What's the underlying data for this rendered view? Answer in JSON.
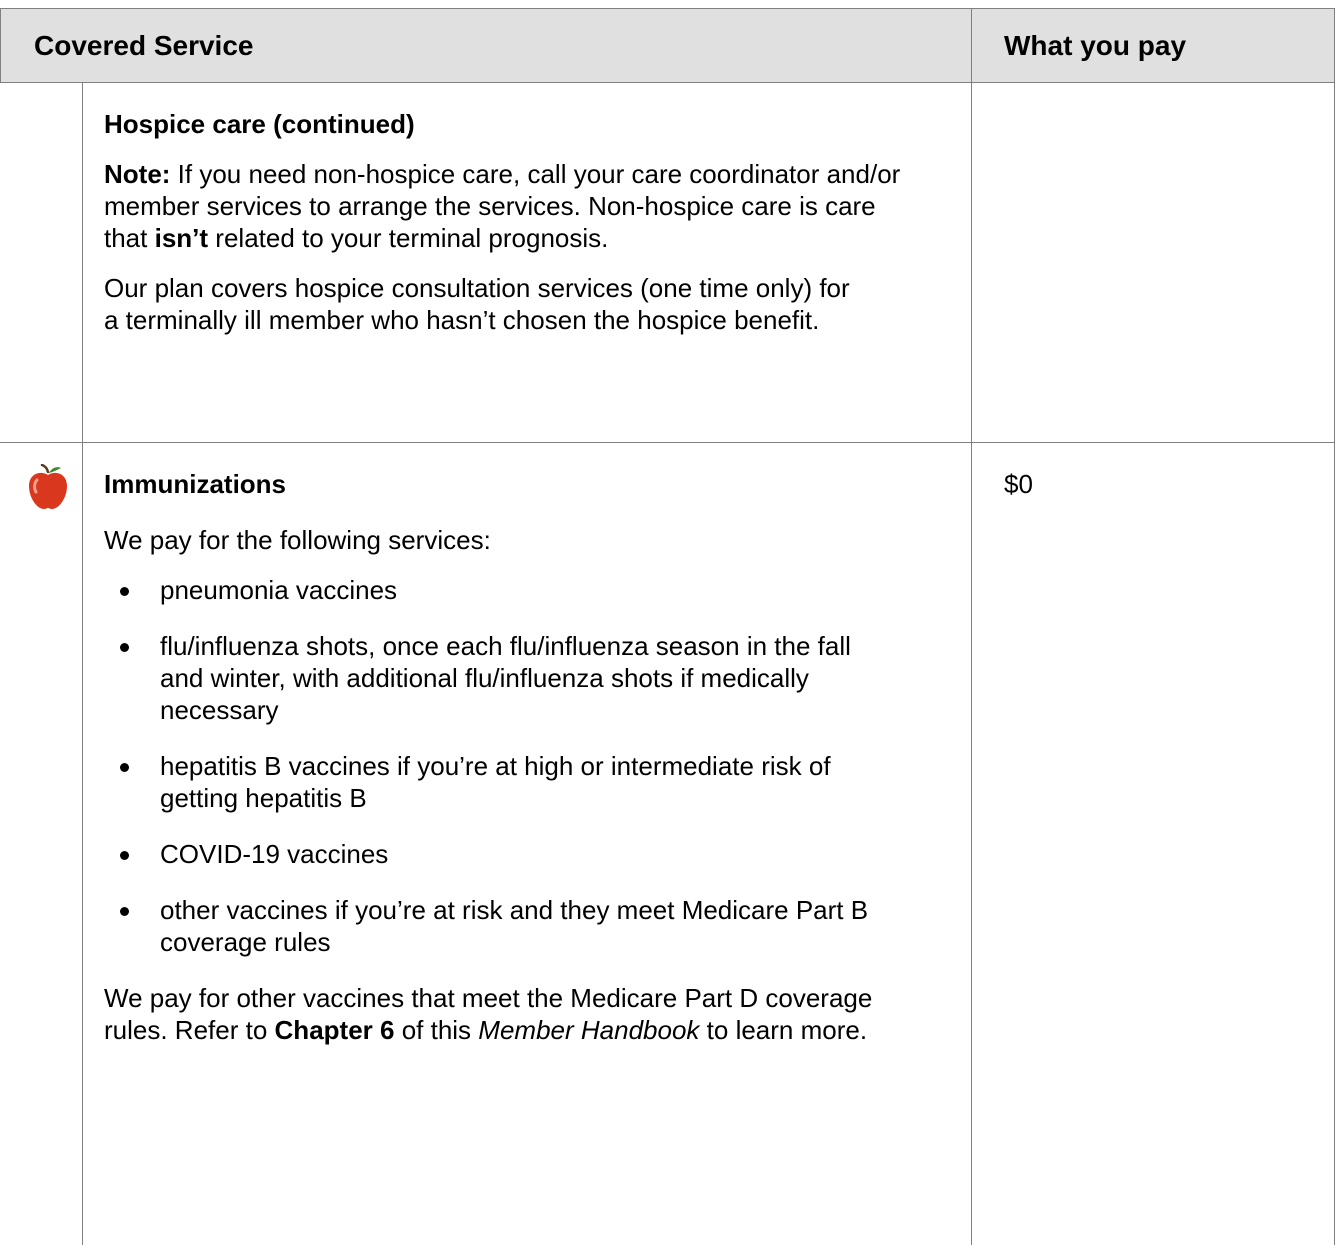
{
  "header": {
    "covered_service": "Covered Service",
    "what_you_pay": "What you pay"
  },
  "rows": [
    {
      "title": "Hospice care (continued)",
      "note_label": "Note:",
      "note_text_1": "If you need non-hospice care, call your care coordinator and/or member services to arrange the services. Non-hospice care is care that",
      "note_bold": "isn’t",
      "note_text_2": "related to your terminal prognosis.",
      "paragraph": "Our plan covers hospice consultation services (one time only) for a terminally ill member who hasn’t chosen the hospice benefit.",
      "pay": ""
    },
    {
      "icon": "apple-icon",
      "title": "Immunizations",
      "intro": "We pay for the following services:",
      "bullets": [
        "pneumonia vaccines",
        "flu/influenza shots, once each flu/influenza season in the fall and winter, with additional flu/influenza shots if medically necessary",
        "hepatitis B vaccines if you’re at high or intermediate risk of getting hepatitis B",
        "COVID-19 vaccines",
        "other vaccines if you’re at risk and they meet Medicare Part B coverage rules"
      ],
      "closing_1": "We pay for other vaccines that meet the Medicare Part D coverage rules. Refer to",
      "closing_bold": "Chapter 6",
      "closing_2": "of this",
      "closing_ital": "Member Handbook",
      "closing_3": "to learn more.",
      "pay": "$0"
    }
  ],
  "colors": {
    "header_bg": "#e0e0e0",
    "border": "#808080",
    "apple_red": "#d9381e"
  }
}
